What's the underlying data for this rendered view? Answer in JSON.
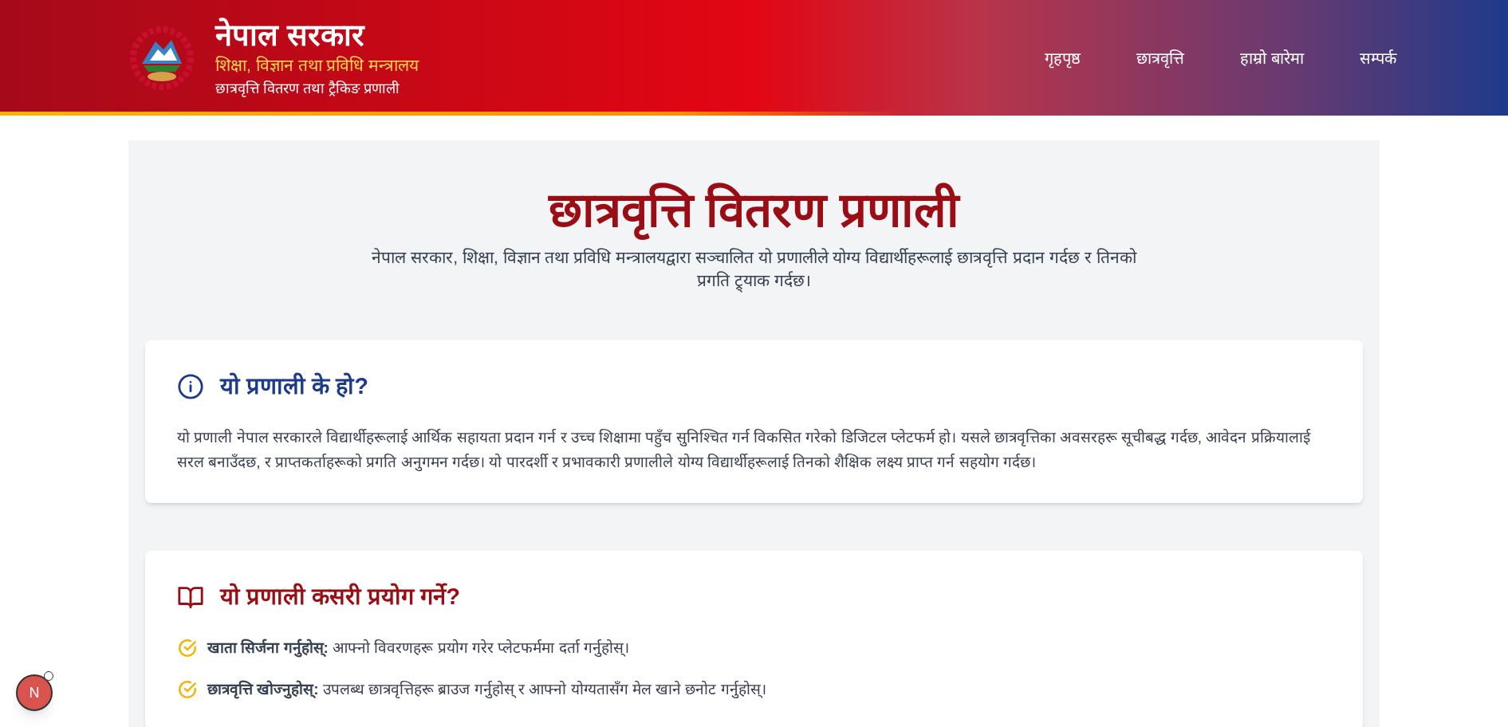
{
  "header": {
    "title": "नेपाल सरकार",
    "subtitle": "शिक्षा, विज्ञान तथा प्रविधि मन्त्रालय",
    "system_name": "छात्रवृत्ति वितरण तथा ट्रैकिङ प्रणाली",
    "nav": [
      "गृहपृष्ठ",
      "छात्रवृत्ति",
      "हाम्रो बारेमा",
      "सम्पर्क"
    ]
  },
  "hero": {
    "title": "छात्रवृत्ति वितरण प्रणाली",
    "description": "नेपाल सरकार, शिक्षा, विज्ञान तथा प्रविधि मन्त्रालयद्वारा सञ्चालित यो प्रणालीले योग्य विद्यार्थीहरूलाई छात्रवृत्ति प्रदान गर्दछ र तिनको प्रगति ट्र्याक गर्दछ।"
  },
  "sections": [
    {
      "kind": "info",
      "title": "यो प्रणाली के हो?",
      "paragraph": "यो प्रणाली नेपाल सरकारले विद्यार्थीहरूलाई आर्थिक सहायता प्रदान गर्न र उच्च शिक्षामा पहुँच सुनिश्चित गर्न विकसित गरेको डिजिटल प्लेटफर्म हो। यसले छात्रवृत्तिका अवसरहरू सूचीबद्ध गर्दछ, आवेदन प्रक्रियालाई सरल बनाउँदछ, र प्राप्तकर्ताहरूको प्रगति अनुगमन गर्दछ। यो पारदर्शी र प्रभावकारी प्रणालीले योग्य विद्यार्थीहरूलाई तिनको शैक्षिक लक्ष्य प्राप्त गर्न सहयोग गर्दछ।"
    },
    {
      "kind": "steps",
      "title": "यो प्रणाली कसरी प्रयोग गर्ने?",
      "items": [
        "**खाता सिर्जना गर्नुहोस्:** आफ्नो विवरणहरू प्रयोग गरेर प्लेटफर्ममा दर्ता गर्नुहोस्।",
        "**छात्रवृत्ति खोज्नुहोस्:** उपलब्ध छात्रवृत्तिहरू ब्राउज गर्नुहोस् र आफ्नो योग्यतासँग मेल खाने छनोट गर्नुहोस्।"
      ]
    }
  ],
  "dev_badge": "N"
}
